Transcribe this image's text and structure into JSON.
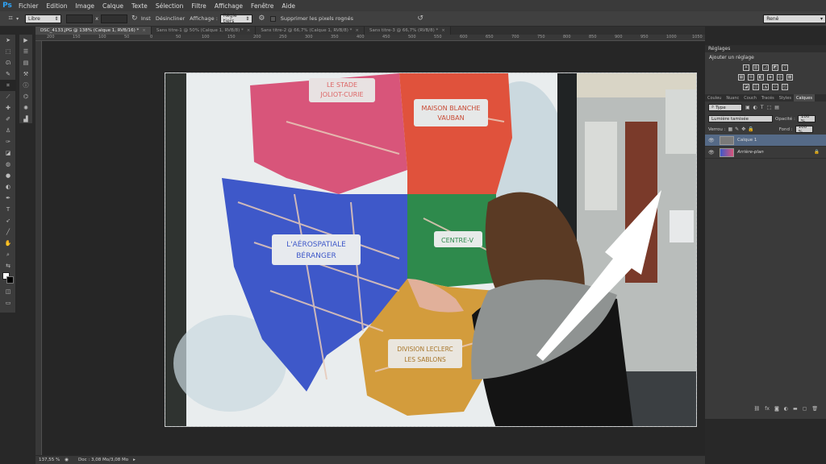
{
  "app": {
    "logo": "Ps",
    "menu": [
      "Fichier",
      "Edition",
      "Image",
      "Calque",
      "Texte",
      "Sélection",
      "Filtre",
      "Affichage",
      "Fenêtre",
      "Aide"
    ]
  },
  "options": {
    "ratio_value": "Libre",
    "x_sep": "x",
    "swap_label": "Inst",
    "clear_label": "Désincliner",
    "view_label": "Affichage :",
    "view_value": "Règle tiers",
    "delete_pixels_label": "Supprimer les pixels rognés",
    "workspace_value": "René"
  },
  "tabs": [
    {
      "label": "DSC_4133.JPG @ 138% (Calque 1, RVB/16) *",
      "active": true
    },
    {
      "label": "Sans titre-1 @ 50% (Calque 1, RVB/8) *",
      "active": false
    },
    {
      "label": "Sans titre-2 @ 66,7% (Calque 1, RVB/8) *",
      "active": false
    },
    {
      "label": "Sans titre-3 @ 66,7% (RVB/8) *",
      "active": false
    }
  ],
  "ruler": {
    "ticks": [
      "200",
      "150",
      "100",
      "50",
      "0",
      "50",
      "100",
      "150",
      "200",
      "250",
      "300",
      "350",
      "400",
      "450",
      "500",
      "550",
      "600",
      "650",
      "700",
      "750",
      "800",
      "850",
      "900",
      "950",
      "1000",
      "1050"
    ]
  },
  "map": {
    "labels": [
      "LE STADE",
      "JOLIOT-CURIE",
      "MAISON BLANCHE",
      "VAUBAN",
      "L'AÉROSPATIALE",
      "BÉRANGER",
      "CENTRE-V",
      "DIVISION LECLERC",
      "LES SABLONS"
    ]
  },
  "status": {
    "zoom": "137,55 %",
    "doc_info": "Doc : 3,08 Mo/3,08 Mo"
  },
  "adjustments": {
    "panel_title": "Réglages",
    "add_label": "Ajouter un réglage"
  },
  "layers_panel": {
    "tabs": [
      {
        "label": "Couleu",
        "active": false
      },
      {
        "label": "Nuanc",
        "active": false
      },
      {
        "label": "Couch",
        "active": false
      },
      {
        "label": "Tracés",
        "active": false
      },
      {
        "label": "Styles",
        "active": false
      },
      {
        "label": "Calques",
        "active": true
      }
    ],
    "filter_type": "Type",
    "blend_mode": "Lumière tamisée",
    "opacity_label": "Opacité :",
    "opacity_value": "100 %",
    "lock_label": "Verrou :",
    "fill_label": "Fond :",
    "fill_value": "100 %",
    "layers": [
      {
        "name": "Calque 1",
        "active": true
      },
      {
        "name": "Arrière-plan",
        "active": false
      }
    ]
  },
  "colors": {
    "accent": "#2fa3f6",
    "selected_layer": "#556a87"
  }
}
